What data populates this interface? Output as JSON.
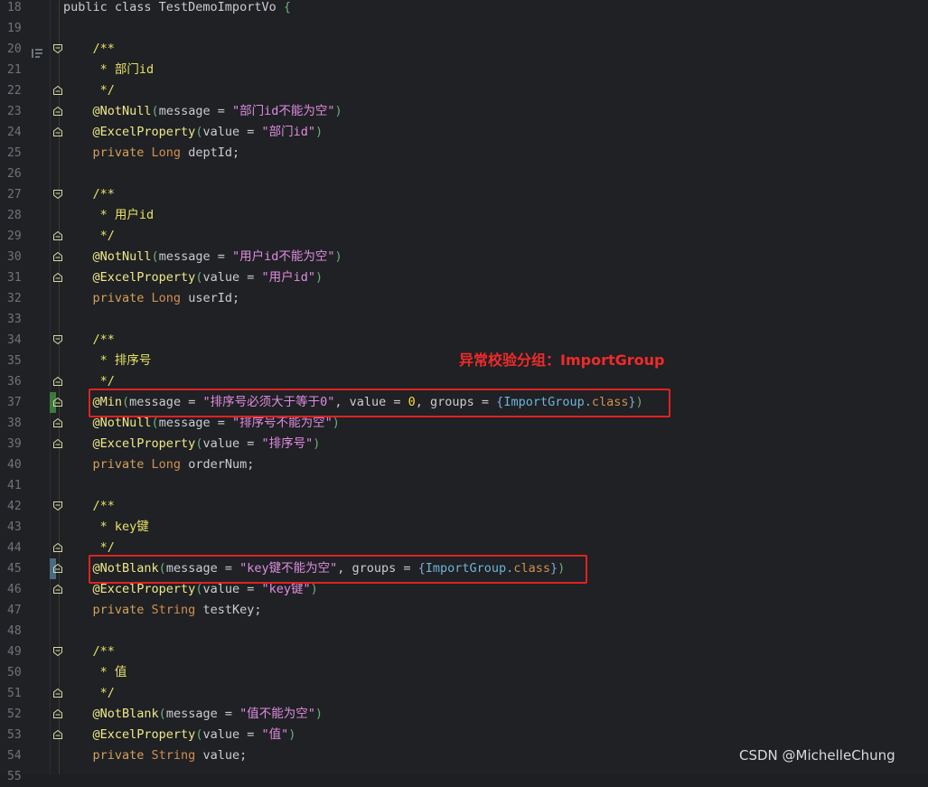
{
  "editor": {
    "lines": [
      {
        "n": "18",
        "parts": [
          [
            "pl",
            "public class TestDemoImportVo "
          ],
          [
            "par",
            "{"
          ]
        ],
        "fold": "none"
      },
      {
        "n": "19",
        "parts": [],
        "fold": "none"
      },
      {
        "n": "20",
        "parts": [
          [
            "cm",
            "    /**"
          ]
        ],
        "fold": "open",
        "bookmark": true
      },
      {
        "n": "21",
        "parts": [
          [
            "cm",
            "     * 部门id"
          ]
        ],
        "fold": "none"
      },
      {
        "n": "22",
        "parts": [
          [
            "cm",
            "     */"
          ]
        ],
        "fold": "close"
      },
      {
        "n": "23",
        "parts": [
          [
            "an",
            "    @NotNull"
          ],
          [
            "par",
            "("
          ],
          [
            "pl",
            "message = "
          ],
          [
            "st",
            "\"部门id不能为空\""
          ],
          [
            "par",
            ")"
          ]
        ],
        "fold": "close"
      },
      {
        "n": "24",
        "parts": [
          [
            "an",
            "    @ExcelProperty"
          ],
          [
            "par",
            "("
          ],
          [
            "pl",
            "value = "
          ],
          [
            "st",
            "\"部门id\""
          ],
          [
            "par",
            ")"
          ]
        ],
        "fold": "close"
      },
      {
        "n": "25",
        "parts": [
          [
            "kw",
            "    private "
          ],
          [
            "ty",
            "Long "
          ],
          [
            "pl",
            "deptId;"
          ]
        ],
        "fold": "none"
      },
      {
        "n": "26",
        "parts": [],
        "fold": "none"
      },
      {
        "n": "27",
        "parts": [
          [
            "cm",
            "    /**"
          ]
        ],
        "fold": "open"
      },
      {
        "n": "28",
        "parts": [
          [
            "cm",
            "     * 用户id"
          ]
        ],
        "fold": "none"
      },
      {
        "n": "29",
        "parts": [
          [
            "cm",
            "     */"
          ]
        ],
        "fold": "close"
      },
      {
        "n": "30",
        "parts": [
          [
            "an",
            "    @NotNull"
          ],
          [
            "par",
            "("
          ],
          [
            "pl",
            "message = "
          ],
          [
            "st",
            "\"用户id不能为空\""
          ],
          [
            "par",
            ")"
          ]
        ],
        "fold": "close"
      },
      {
        "n": "31",
        "parts": [
          [
            "an",
            "    @ExcelProperty"
          ],
          [
            "par",
            "("
          ],
          [
            "pl",
            "value = "
          ],
          [
            "st",
            "\"用户id\""
          ],
          [
            "par",
            ")"
          ]
        ],
        "fold": "close"
      },
      {
        "n": "32",
        "parts": [
          [
            "kw",
            "    private "
          ],
          [
            "ty",
            "Long "
          ],
          [
            "pl",
            "userId;"
          ]
        ],
        "fold": "none"
      },
      {
        "n": "33",
        "parts": [],
        "fold": "none"
      },
      {
        "n": "34",
        "parts": [
          [
            "cm",
            "    /**"
          ]
        ],
        "fold": "open"
      },
      {
        "n": "35",
        "parts": [
          [
            "cm",
            "     * 排序号"
          ]
        ],
        "fold": "none"
      },
      {
        "n": "36",
        "parts": [
          [
            "cm",
            "     */"
          ]
        ],
        "fold": "close"
      },
      {
        "n": "37",
        "parts": [
          [
            "an",
            "    @Min"
          ],
          [
            "par",
            "("
          ],
          [
            "pl",
            "message = "
          ],
          [
            "st",
            "\"排序号必须大于等于0\""
          ],
          [
            "pl",
            ", value = "
          ],
          [
            "num",
            "0"
          ],
          [
            "pl",
            ", groups = "
          ],
          [
            "br",
            "{"
          ],
          [
            "cls",
            "ImportGroup."
          ],
          [
            "ty",
            "class"
          ],
          [
            "br",
            "}"
          ],
          [
            "par",
            ")"
          ]
        ],
        "fold": "close",
        "modified": true
      },
      {
        "n": "38",
        "parts": [
          [
            "an",
            "    @NotNull"
          ],
          [
            "par",
            "("
          ],
          [
            "pl",
            "message = "
          ],
          [
            "st",
            "\"排序号不能为空\""
          ],
          [
            "par",
            ")"
          ]
        ],
        "fold": "close"
      },
      {
        "n": "39",
        "parts": [
          [
            "an",
            "    @ExcelProperty"
          ],
          [
            "par",
            "("
          ],
          [
            "pl",
            "value = "
          ],
          [
            "st",
            "\"排序号\""
          ],
          [
            "par",
            ")"
          ]
        ],
        "fold": "close"
      },
      {
        "n": "40",
        "parts": [
          [
            "kw",
            "    private "
          ],
          [
            "ty",
            "Long "
          ],
          [
            "pl",
            "orderNum;"
          ]
        ],
        "fold": "none"
      },
      {
        "n": "41",
        "parts": [],
        "fold": "none"
      },
      {
        "n": "42",
        "parts": [
          [
            "cm",
            "    /**"
          ]
        ],
        "fold": "open"
      },
      {
        "n": "43",
        "parts": [
          [
            "cm",
            "     * key键"
          ]
        ],
        "fold": "none"
      },
      {
        "n": "44",
        "parts": [
          [
            "cm",
            "     */"
          ]
        ],
        "fold": "close"
      },
      {
        "n": "45",
        "parts": [
          [
            "an",
            "    @NotBlank"
          ],
          [
            "par",
            "("
          ],
          [
            "pl",
            "message = "
          ],
          [
            "st",
            "\"key键不能为空\""
          ],
          [
            "pl",
            ", groups = "
          ],
          [
            "br",
            "{"
          ],
          [
            "cls",
            "ImportGroup."
          ],
          [
            "ty",
            "class"
          ],
          [
            "br",
            "}"
          ],
          [
            "par",
            ")"
          ]
        ],
        "fold": "close",
        "modified2": true
      },
      {
        "n": "46",
        "parts": [
          [
            "an",
            "    @ExcelProperty"
          ],
          [
            "par",
            "("
          ],
          [
            "pl",
            "value = "
          ],
          [
            "st",
            "\"key键\""
          ],
          [
            "par",
            ")"
          ]
        ],
        "fold": "close"
      },
      {
        "n": "47",
        "parts": [
          [
            "kw",
            "    private "
          ],
          [
            "ty",
            "String "
          ],
          [
            "pl",
            "testKey;"
          ]
        ],
        "fold": "none"
      },
      {
        "n": "48",
        "parts": [],
        "fold": "none"
      },
      {
        "n": "49",
        "parts": [
          [
            "cm",
            "    /**"
          ]
        ],
        "fold": "open"
      },
      {
        "n": "50",
        "parts": [
          [
            "cm",
            "     * 值"
          ]
        ],
        "fold": "none"
      },
      {
        "n": "51",
        "parts": [
          [
            "cm",
            "     */"
          ]
        ],
        "fold": "close"
      },
      {
        "n": "52",
        "parts": [
          [
            "an",
            "    @NotBlank"
          ],
          [
            "par",
            "("
          ],
          [
            "pl",
            "message = "
          ],
          [
            "st",
            "\"值不能为空\""
          ],
          [
            "par",
            ")"
          ]
        ],
        "fold": "close"
      },
      {
        "n": "53",
        "parts": [
          [
            "an",
            "    @ExcelProperty"
          ],
          [
            "par",
            "("
          ],
          [
            "pl",
            "value = "
          ],
          [
            "st",
            "\"值\""
          ],
          [
            "par",
            ")"
          ]
        ],
        "fold": "close"
      },
      {
        "n": "54",
        "parts": [
          [
            "kw",
            "    private "
          ],
          [
            "ty",
            "String "
          ],
          [
            "pl",
            "value;"
          ]
        ],
        "fold": "none"
      },
      {
        "n": "55",
        "parts": [],
        "fold": "none"
      }
    ]
  },
  "annotation": {
    "note": "异常校验分组：ImportGroup"
  },
  "watermark": "CSDN @MichelleChung",
  "colors": {
    "highlight_box": "#e02222",
    "background": "#1f2124"
  }
}
